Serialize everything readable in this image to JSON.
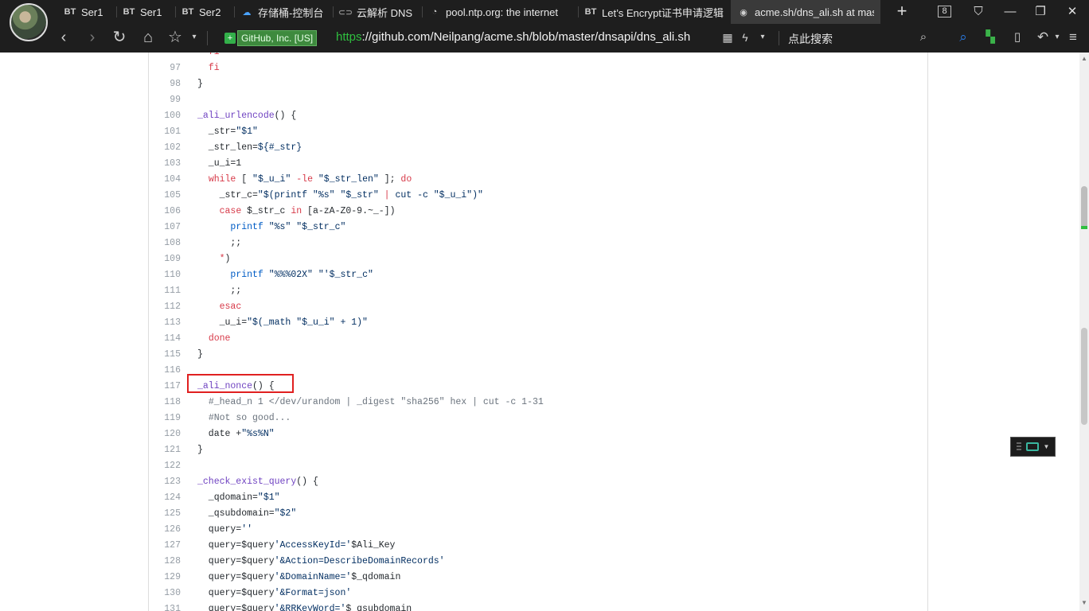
{
  "tabs": [
    {
      "icon": "BT",
      "label": "Ser1"
    },
    {
      "icon": "BT",
      "label": "Ser1"
    },
    {
      "icon": "BT",
      "label": "Ser2"
    },
    {
      "icon": "cloud-icon",
      "label": "存储桶-控制台"
    },
    {
      "icon": "cloud-dns-icon",
      "label": "云解析 DNS"
    },
    {
      "icon": "page-icon",
      "label": "pool.ntp.org: the internet"
    },
    {
      "icon": "BT",
      "label": "Let’s Encrypt证书申请逻辑"
    },
    {
      "icon": "github-icon",
      "label": "acme.sh/dns_ali.sh at mas"
    }
  ],
  "tab_count": "8",
  "address": {
    "cert_org": "GitHub, Inc. [US]",
    "scheme": "https",
    "rest": "://github.com/Neilpang/acme.sh/blob/master/dnsapi/dns_ali.sh"
  },
  "search_placeholder": "点此搜索",
  "code_lines": [
    {
      "n": "",
      "html": "  <span class=\"kw\">fi</span>"
    },
    {
      "n": "97",
      "html": "  <span class=\"kw\">fi</span>"
    },
    {
      "n": "98",
      "html": "}"
    },
    {
      "n": "99",
      "html": ""
    },
    {
      "n": "100",
      "html": "<span class=\"fn\">_ali_urlencode</span>() {"
    },
    {
      "n": "101",
      "html": "  _str=<span class=\"str\">\"$1\"</span>"
    },
    {
      "n": "102",
      "html": "  _str_len=<span class=\"str\">${#_str}</span>"
    },
    {
      "n": "103",
      "html": "  _u_i=1"
    },
    {
      "n": "104",
      "html": "  <span class=\"kw\">while</span> [ <span class=\"str\">\"$_u_i\"</span> <span class=\"kw\">-le</span> <span class=\"str\">\"$_str_len\"</span> ]; <span class=\"kw\">do</span>"
    },
    {
      "n": "105",
      "html": "    _str_c=<span class=\"str\">\"$(printf \"%s\" \"$_str\" <span class=\"kw\">|</span> cut -c \"$_u_i\")\"</span>"
    },
    {
      "n": "106",
      "html": "    <span class=\"kw\">case</span> $_str_c <span class=\"kw\">in</span> [a-zA-Z0-9.~_-])"
    },
    {
      "n": "107",
      "html": "      <span class=\"ent\">printf</span> <span class=\"str\">\"%s\"</span> <span class=\"str\">\"$_str_c\"</span>"
    },
    {
      "n": "108",
      "html": "      ;;"
    },
    {
      "n": "109",
      "html": "    <span class=\"kw\">*</span>)"
    },
    {
      "n": "110",
      "html": "      <span class=\"ent\">printf</span> <span class=\"str\">\"%%%02X\"</span> <span class=\"str\">\"'$_str_c\"</span>"
    },
    {
      "n": "111",
      "html": "      ;;"
    },
    {
      "n": "112",
      "html": "    <span class=\"kw\">esac</span>"
    },
    {
      "n": "113",
      "html": "    _u_i=<span class=\"str\">\"$(_math \"$_u_i\" + 1)\"</span>"
    },
    {
      "n": "114",
      "html": "  <span class=\"kw\">done</span>"
    },
    {
      "n": "115",
      "html": "}"
    },
    {
      "n": "116",
      "html": ""
    },
    {
      "n": "117",
      "html": "<span class=\"fn\">_ali_nonce</span>() {"
    },
    {
      "n": "118",
      "html": "  <span class=\"cmt\">#_head_n 1 &lt;/dev/urandom | _digest \"sha256\" hex | cut -c 1-31</span>"
    },
    {
      "n": "119",
      "html": "  <span class=\"cmt\">#Not so good...</span>"
    },
    {
      "n": "120",
      "html": "  date +<span class=\"str\">\"%s%N\"</span>"
    },
    {
      "n": "121",
      "html": "}"
    },
    {
      "n": "122",
      "html": ""
    },
    {
      "n": "123",
      "html": "<span class=\"fn\">_check_exist_query</span>() {"
    },
    {
      "n": "124",
      "html": "  _qdomain=<span class=\"str\">\"$1\"</span>"
    },
    {
      "n": "125",
      "html": "  _qsubdomain=<span class=\"str\">\"$2\"</span>"
    },
    {
      "n": "126",
      "html": "  query=<span class=\"str\">''</span>"
    },
    {
      "n": "127",
      "html": "  query=$query<span class=\"str\">'AccessKeyId='</span>$Ali_Key"
    },
    {
      "n": "128",
      "html": "  query=$query<span class=\"str\">'&amp;Action=DescribeDomainRecords'</span>"
    },
    {
      "n": "129",
      "html": "  query=$query<span class=\"str\">'&amp;DomainName='</span>$_qdomain"
    },
    {
      "n": "130",
      "html": "  query=$query<span class=\"str\">'&amp;Format=json'</span>"
    },
    {
      "n": "131",
      "html": "  query=$query<span class=\"str\">'&amp;RRKeyWord='</span>$_qsubdomain"
    }
  ],
  "highlighted_line": "120"
}
